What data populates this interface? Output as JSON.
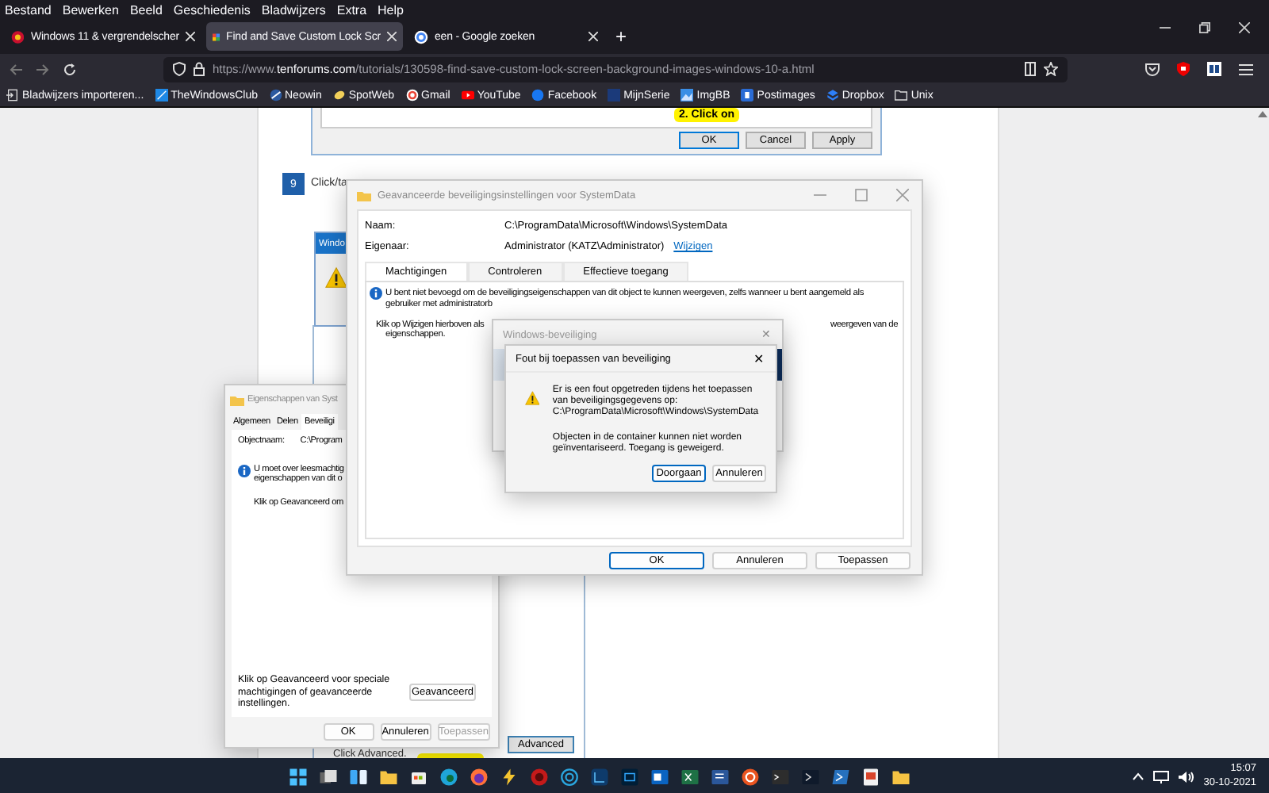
{
  "browser": {
    "menu": [
      "Bestand",
      "Bewerken",
      "Beeld",
      "Geschiedenis",
      "Bladwijzers",
      "Extra",
      "Help"
    ],
    "tabs": [
      {
        "title": "Windows 11 & vergrendelscher",
        "selected": false
      },
      {
        "title": "Find and Save Custom Lock Scr",
        "selected": true
      },
      {
        "title": "een - Google zoeken",
        "selected": false
      }
    ],
    "new_tab": "+",
    "url": {
      "scheme": "https://www.",
      "host": "tenforums.com",
      "path": "/tutorials/130598-find-save-custom-lock-screen-background-images-windows-10-a.html"
    },
    "bookmarks": [
      "Bladwijzers importeren...",
      "TheWindowsClub",
      "Neowin",
      "SpotWeb",
      "Gmail",
      "YouTube",
      "Facebook",
      "MijnSerie",
      "ImgBB",
      "Postimages",
      "Dropbox",
      "Unix"
    ]
  },
  "article": {
    "callout": "2. Click on",
    "dialog_buttons": [
      {
        "label": "OK",
        "default": true
      },
      {
        "label": "Cancel",
        "default": false
      },
      {
        "label": "Apply",
        "default": false
      }
    ],
    "step_number": "9",
    "step_text": "Click/ta",
    "behind_window_title": "Windo",
    "lower_text": "Click Advanced.",
    "advanced_button": "Advanced"
  },
  "advanced_window": {
    "title": "Geavanceerde beveiligingsinstellingen voor SystemData",
    "fields": [
      {
        "label": "Naam:",
        "value": "C:\\ProgramData\\Microsoft\\Windows\\SystemData"
      },
      {
        "label": "Eigenaar:",
        "value": "Administrator (KATZ\\Administrator)",
        "link": "Wijzigen"
      }
    ],
    "tabs": [
      {
        "label": "Machtigingen",
        "selected": true
      },
      {
        "label": "Controleren",
        "selected": false
      },
      {
        "label": "Effectieve toegang",
        "selected": false
      }
    ],
    "info_lines": [
      "U bent niet bevoegd om de beveiligingseigenschappen van dit object te kunnen weergeven, zelfs wanneer u bent aangemeld als",
      "gebruiker met administratorb"
    ],
    "hint_left": "Klik op Wijzigen hierboven als",
    "hint_right": "weergeven van de",
    "hint_end": "eigenschappen.",
    "buttons": [
      {
        "label": "OK",
        "default": true
      },
      {
        "label": "Annuleren",
        "default": false
      },
      {
        "label": "Toepassen",
        "default": false
      }
    ]
  },
  "security_window": {
    "title": "Windows-beveiliging",
    "close": "✕"
  },
  "error_dialog": {
    "title": "Fout bij toepassen van beveiliging",
    "close": "✕",
    "message": "Er is een fout opgetreden tijdens het toepassen van beveiligingsgegevens op:",
    "path": "C:\\ProgramData\\Microsoft\\Windows\\SystemData",
    "detail": "Objecten in de container kunnen niet worden geïnventariseerd. Toegang is geweigerd.",
    "buttons": [
      {
        "label": "Doorgaan",
        "default": true
      },
      {
        "label": "Annuleren",
        "default": false
      }
    ]
  },
  "properties_window": {
    "title": "Eigenschappen van Syst",
    "tabs": [
      {
        "label": "Algemeen",
        "selected": false
      },
      {
        "label": "Delen",
        "selected": false
      },
      {
        "label": "Beveiligi",
        "selected": true
      }
    ],
    "object_label": "Objectnaam:",
    "object_value": "C:\\Program",
    "info_lines": [
      "U moet over leesmachtig",
      "eigenschappen van dit o"
    ],
    "hint": "Klik op Geavanceerd om",
    "advanced_text": "Klik op Geavanceerd voor speciale machtigingen of geavanceerde instellingen.",
    "advanced_button": "Geavanceerd",
    "buttons": [
      {
        "label": "OK",
        "disabled": false
      },
      {
        "label": "Annuleren",
        "disabled": false
      },
      {
        "label": "Toepassen",
        "disabled": true
      }
    ]
  },
  "taskbar": {
    "time": "15:07",
    "date": "30-10-2021"
  }
}
